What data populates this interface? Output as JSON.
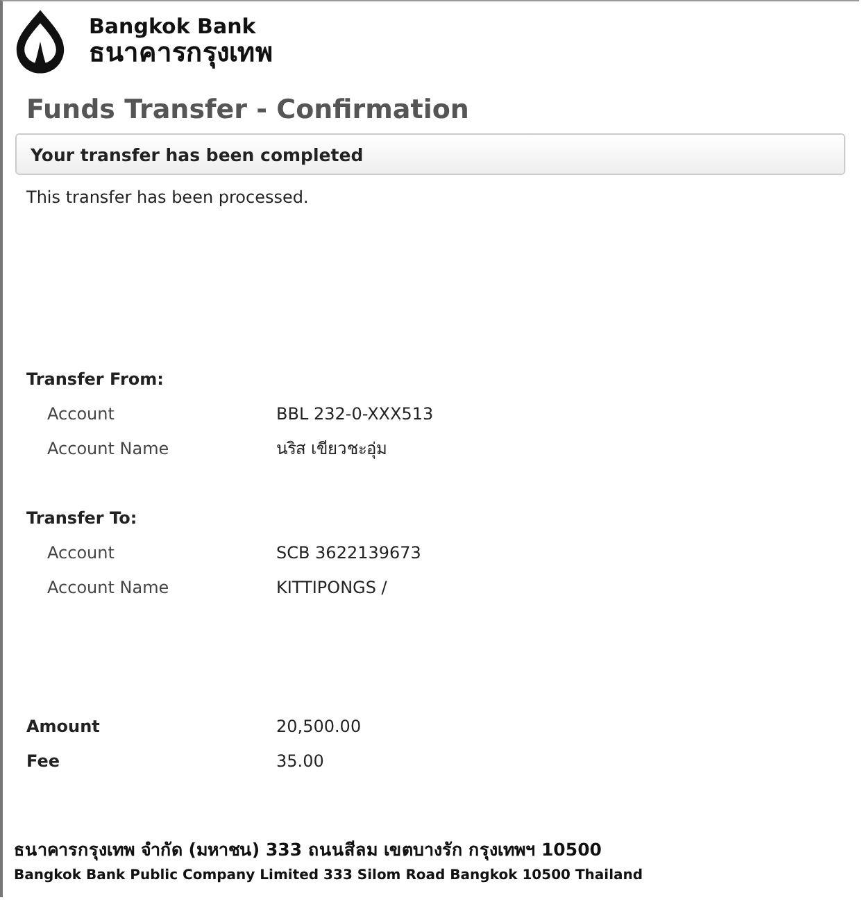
{
  "logo": {
    "name_en": "Bangkok Bank",
    "name_th": "ธนาคารกรุงเทพ"
  },
  "page_title": "Funds Transfer - Confirmation",
  "status_box": "Your transfer has been completed",
  "message": "This transfer has been processed.",
  "sections": [
    {
      "heading": "Transfer From:",
      "rows": [
        {
          "label": "Account",
          "value": "BBL 232-0-XXX513"
        },
        {
          "label": "Account Name",
          "value": "นริส เขียวชะอุ่ม"
        }
      ]
    },
    {
      "heading": "Transfer To:",
      "rows": [
        {
          "label": "Account",
          "value": "SCB 3622139673"
        },
        {
          "label": "Account Name",
          "value": "KITTIPONGS /"
        }
      ]
    }
  ],
  "totals": [
    {
      "label": "Amount",
      "value": "20,500.00"
    },
    {
      "label": "Fee",
      "value": "35.00"
    }
  ],
  "footer": {
    "line_th": "ธนาคารกรุงเทพ จำกัด (มหาชน)  333 ถนนสีลม เขตบางรัก กรุงเทพฯ 10500",
    "line_en": "Bangkok Bank Public Company Limited 333 Silom Road Bangkok 10500 Thailand"
  }
}
